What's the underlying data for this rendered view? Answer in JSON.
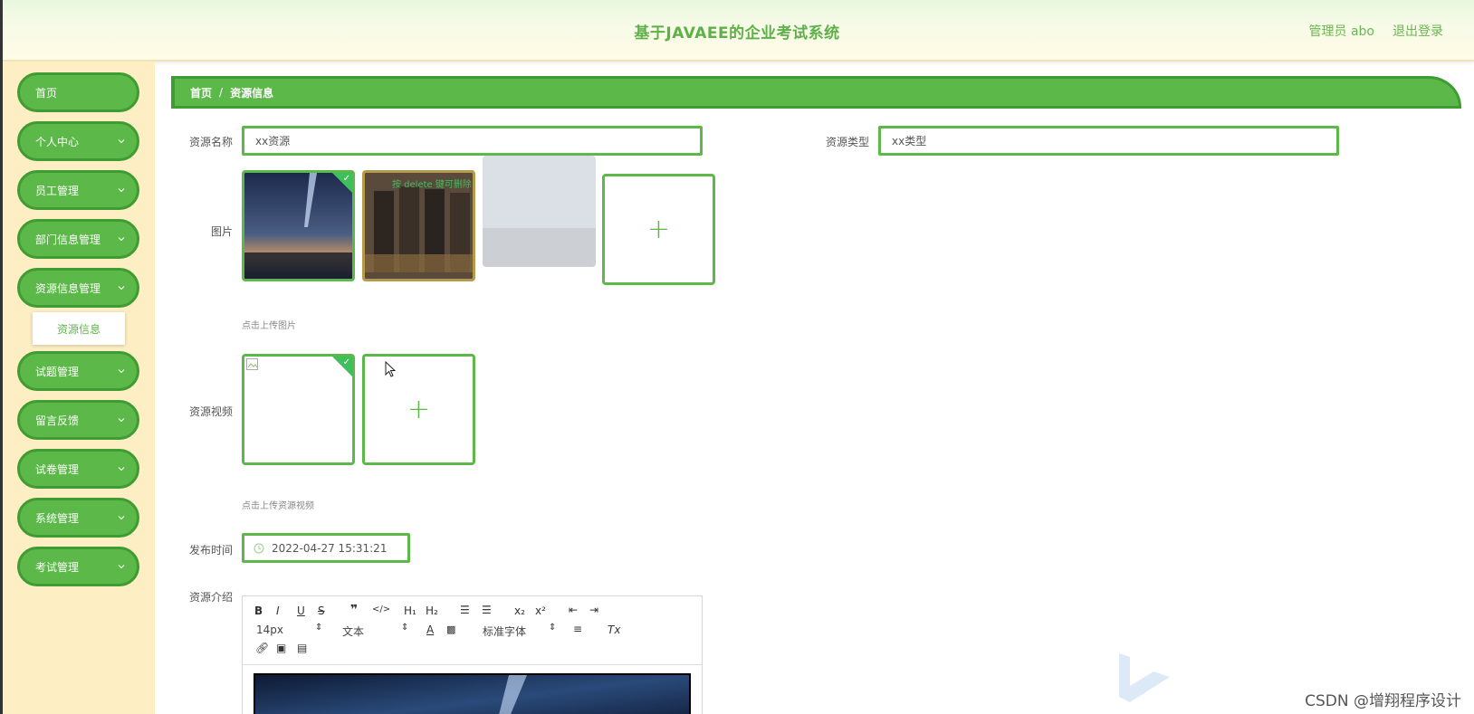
{
  "header": {
    "title": "基于JAVAEE的企业考试系统",
    "user": "管理员 abo",
    "logout": "退出登录"
  },
  "sidebar": {
    "items": [
      {
        "label": "首页",
        "has_arrow": false
      },
      {
        "label": "个人中心",
        "has_arrow": true
      },
      {
        "label": "员工管理",
        "has_arrow": true
      },
      {
        "label": "部门信息管理",
        "has_arrow": true
      },
      {
        "label": "资源信息管理",
        "has_arrow": true
      },
      {
        "label": "试题管理",
        "has_arrow": true
      },
      {
        "label": "留言反馈",
        "has_arrow": true
      },
      {
        "label": "试卷管理",
        "has_arrow": true
      },
      {
        "label": "系统管理",
        "has_arrow": true
      },
      {
        "label": "考试管理",
        "has_arrow": true
      }
    ],
    "submenu": {
      "label": "资源信息"
    }
  },
  "breadcrumb": {
    "home": "首页",
    "separator": "/",
    "current": "资源信息"
  },
  "form": {
    "name_label": "资源名称",
    "name_value": "xx资源",
    "type_label": "资源类型",
    "type_value": "xx类型",
    "image_label": "图片",
    "image_hint": "点击上传图片",
    "image_overlay_text": "按 delete 键可删除",
    "video_label": "资源视频",
    "video_hint": "点击上传资源视频",
    "time_label": "发布时间",
    "time_value": "2022-04-27 15:31:21",
    "intro_label": "资源介绍"
  },
  "editor": {
    "font_size": "14px",
    "text_style": "文本",
    "font_family": "标准字体"
  },
  "watermark": "CSDN @增翔程序设计",
  "colors": {
    "accent": "#5cb849",
    "accent_dark": "#3f9c33",
    "sidebar_bg": "#fdeec3",
    "check": "#3fbf5b"
  }
}
